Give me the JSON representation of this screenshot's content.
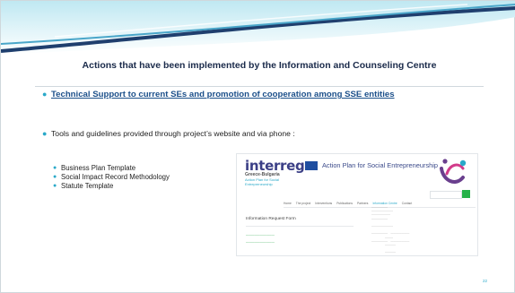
{
  "slide": {
    "title": "Actions that have been implemented by the Information and Counseling Centre",
    "bullet1": "Technical Support to current SEs and promotion of cooperation among SSE entities",
    "bullet2": "Tools and guidelines provided through project’s website and via phone :",
    "sub_items": [
      "Business Plan Template",
      "Social Impact Record Methodology",
      "Statute Template"
    ],
    "page_number": "22",
    "accent_color": "#2aa9c9"
  },
  "website_thumbnail": {
    "logo": "interreg",
    "logo_region": "Greece-Bulgaria",
    "logo_tagline": "Action Plan for Social Entrepreneurship",
    "heading": "Action Plan for Social Entrepreneurship",
    "form_title": "Information Request Form",
    "search_icon": "search-icon"
  }
}
